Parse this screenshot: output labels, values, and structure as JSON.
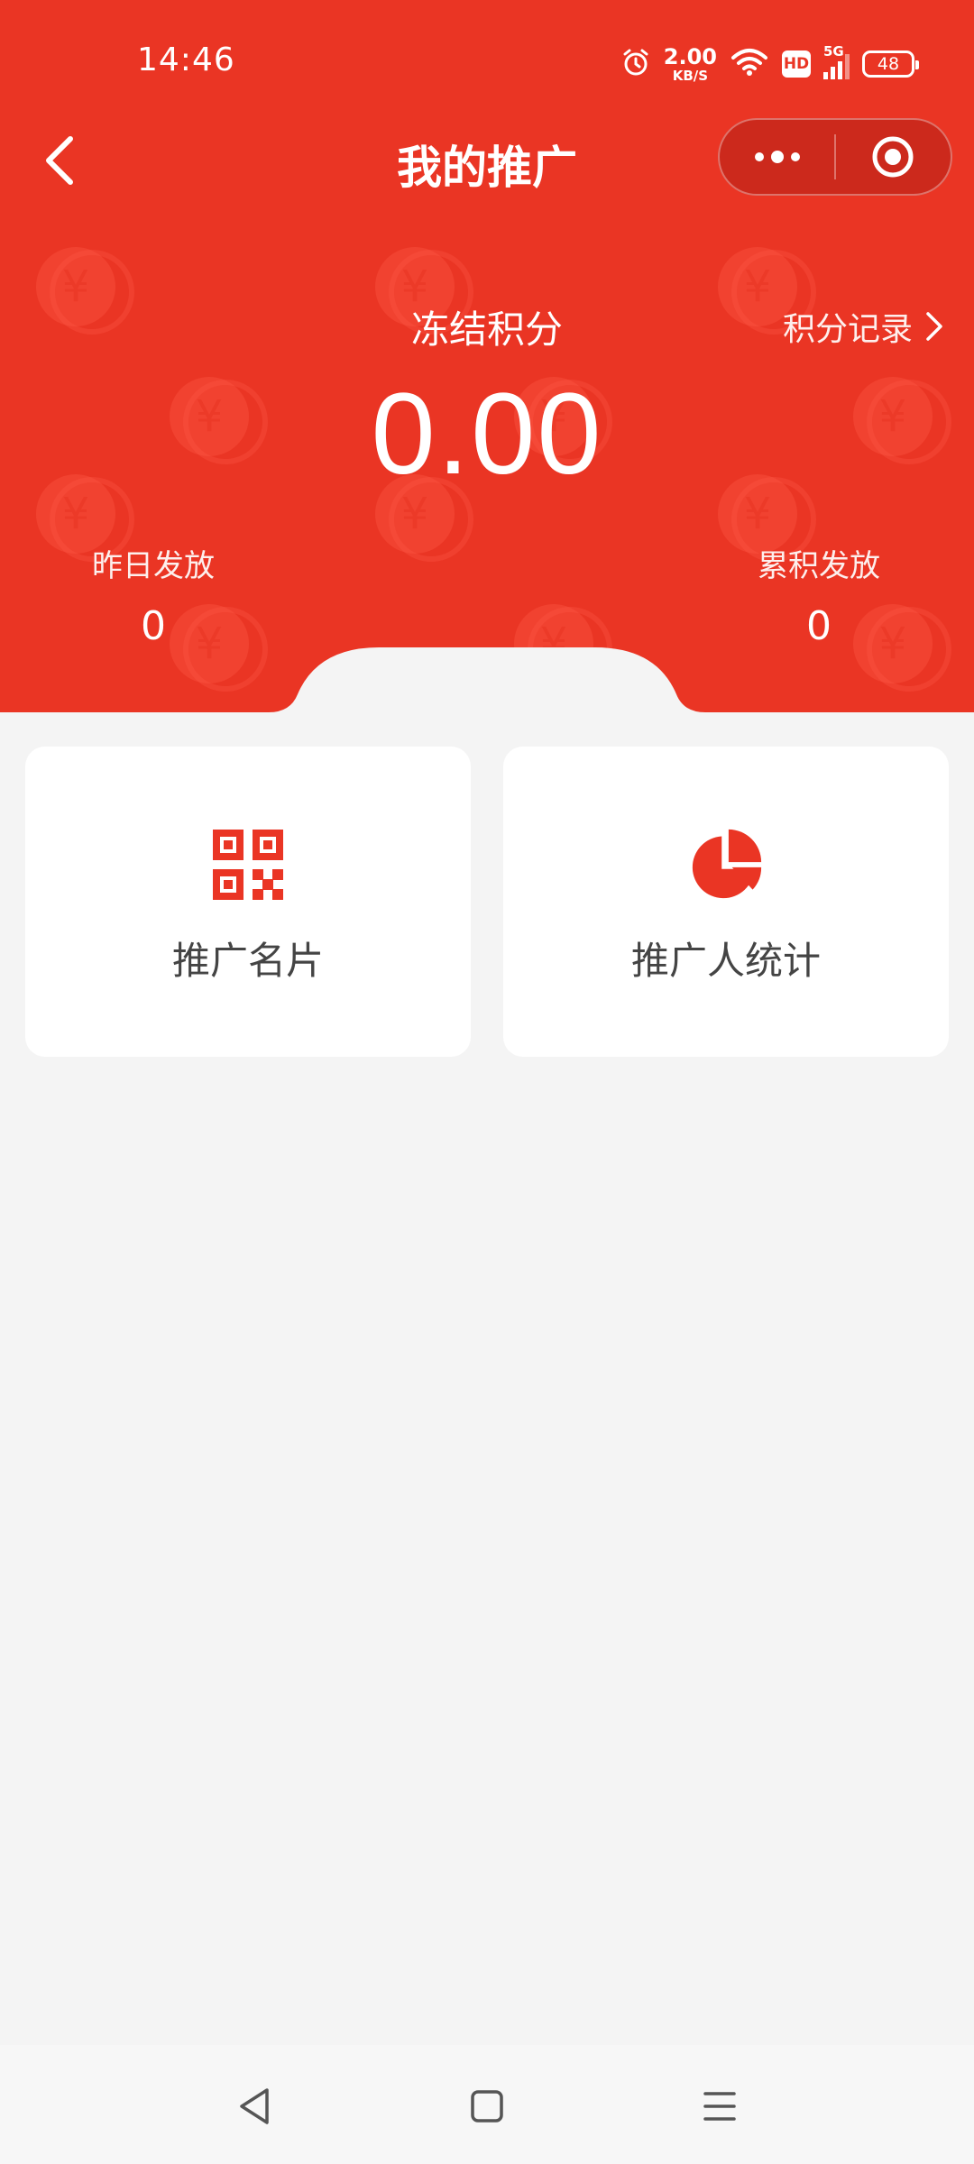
{
  "status_bar": {
    "time": "14:46",
    "net_speed_value": "2.00",
    "net_speed_unit": "KB/S",
    "hd": "HD",
    "network": "5G",
    "battery": "48"
  },
  "header": {
    "title": "我的推广"
  },
  "points": {
    "label": "冻结积分",
    "value": "0.00",
    "record_link": "积分记录"
  },
  "stats": [
    {
      "label": "昨日发放",
      "value": "0"
    },
    {
      "label": "累积发放",
      "value": "0"
    }
  ],
  "cards": [
    {
      "label": "推广名片",
      "icon": "qr-code-icon"
    },
    {
      "label": "推广人统计",
      "icon": "pie-chart-icon"
    }
  ],
  "colors": {
    "brand": "#ea3524",
    "background": "#f4f4f4",
    "card": "#ffffff"
  }
}
